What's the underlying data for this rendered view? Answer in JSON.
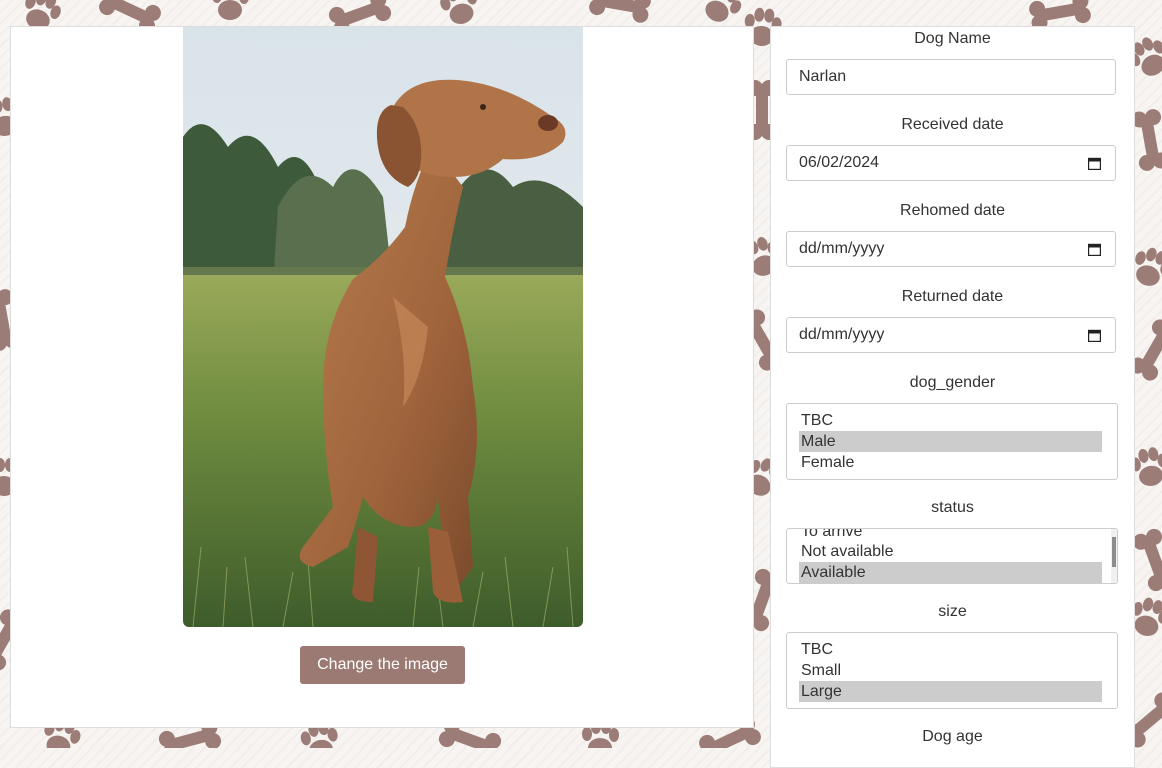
{
  "colors": {
    "accent": "#9a7a72",
    "pattern": "#9c7c76",
    "selected": "#cccccc"
  },
  "left_panel": {
    "image_alt": "Brown vizsla dog sitting on grass",
    "change_image_label": "Change the image"
  },
  "form": {
    "dog_name": {
      "label": "Dog Name",
      "value": "Narlan"
    },
    "received_date": {
      "label": "Received date",
      "value": "06/02/2024",
      "icon": "calendar-icon"
    },
    "rehomed_date": {
      "label": "Rehomed date",
      "value": "dd/mm/yyyy",
      "icon": "calendar-icon"
    },
    "returned_date": {
      "label": "Returned date",
      "value": "dd/mm/yyyy",
      "icon": "calendar-icon"
    },
    "dog_gender": {
      "label": "dog_gender",
      "options": [
        "TBC",
        "Male",
        "Female"
      ],
      "selected": "Male"
    },
    "status": {
      "label": "status",
      "options": [
        "To arrive",
        "Not available",
        "Available"
      ],
      "selected": "Available"
    },
    "size": {
      "label": "size",
      "options": [
        "TBC",
        "Small",
        "Large"
      ],
      "selected": "Large"
    },
    "dog_age": {
      "label": "Dog age"
    }
  }
}
